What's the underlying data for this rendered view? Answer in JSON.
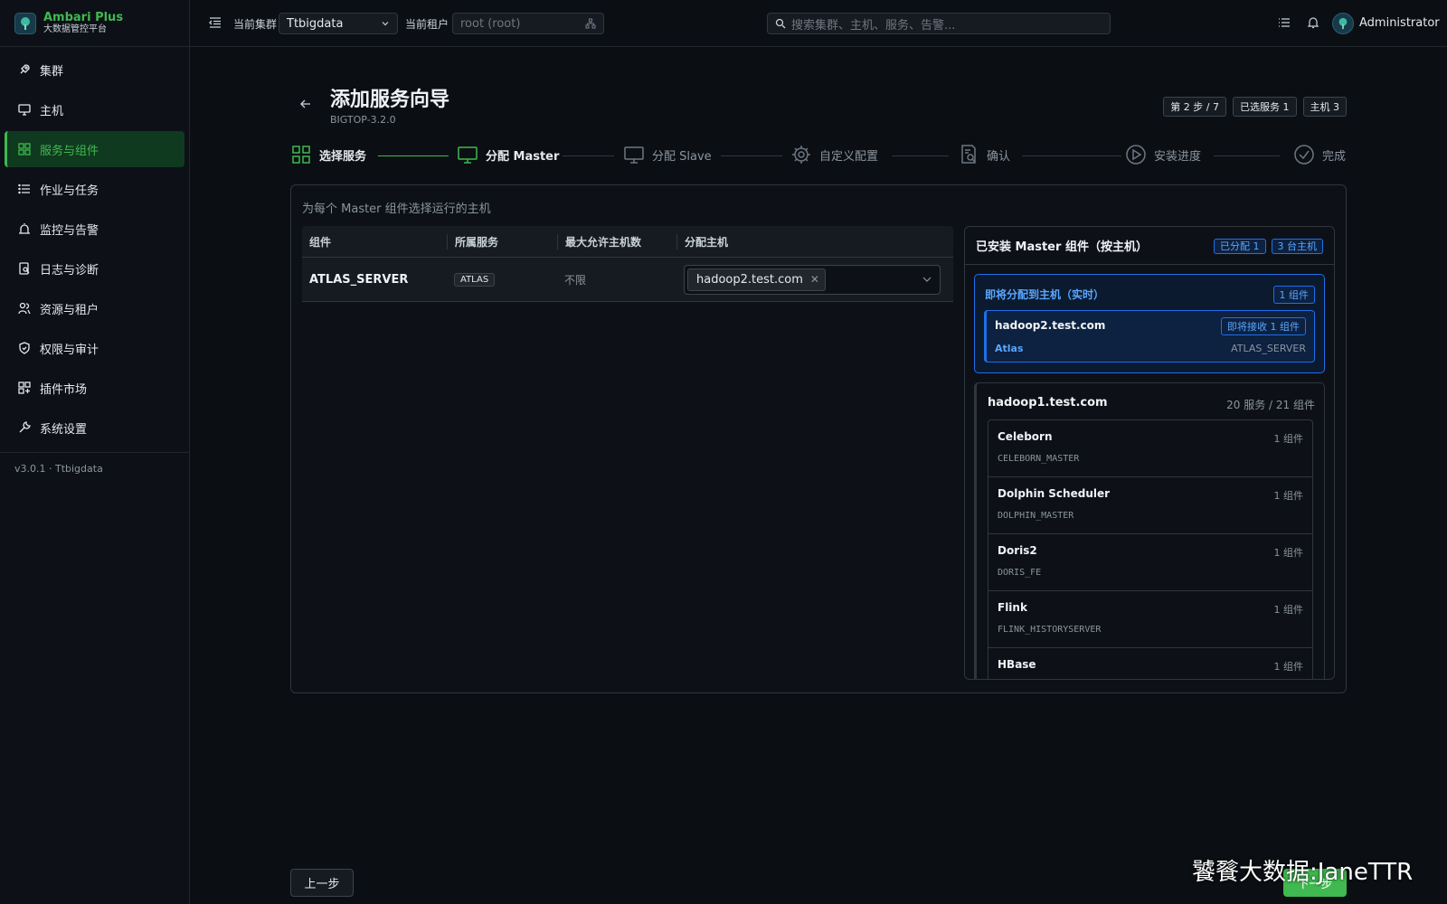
{
  "brand": {
    "title": "Ambari Plus",
    "subtitle": "大数据管控平台"
  },
  "sidebar": {
    "items": [
      {
        "label": "集群",
        "icon": "rocket-icon"
      },
      {
        "label": "主机",
        "icon": "monitor-icon"
      },
      {
        "label": "服务与组件",
        "icon": "grid-icon",
        "active": true
      },
      {
        "label": "作业与任务",
        "icon": "list-icon"
      },
      {
        "label": "监控与告警",
        "icon": "alarm-icon"
      },
      {
        "label": "日志与诊断",
        "icon": "log-icon"
      },
      {
        "label": "资源与租户",
        "icon": "users-icon"
      },
      {
        "label": "权限与审计",
        "icon": "shield-icon"
      },
      {
        "label": "插件市场",
        "icon": "puzzle-icon"
      },
      {
        "label": "系统设置",
        "icon": "wrench-icon"
      }
    ],
    "version": "v3.0.1 · Ttbigdata"
  },
  "topbar": {
    "cluster_label": "当前集群",
    "cluster_value": "Ttbigdata",
    "tenant_label": "当前租户",
    "tenant_placeholder": "root (root)",
    "search_placeholder": "搜索集群、主机、服务、告警...",
    "user_name": "Administrator"
  },
  "page": {
    "title": "添加服务向导",
    "subtitle": "BIGTOP-3.2.0",
    "badges": [
      "第 2 步 / 7",
      "已选服务 1",
      "主机 3"
    ]
  },
  "steps": [
    {
      "label": "选择服务",
      "state": "done",
      "icon": "grid-icon"
    },
    {
      "label": "分配 Master",
      "state": "current",
      "icon": "monitor-icon"
    },
    {
      "label": "分配 Slave",
      "state": "pending",
      "icon": "monitor-icon"
    },
    {
      "label": "自定义配置",
      "state": "pending",
      "icon": "gear-icon"
    },
    {
      "label": "确认",
      "state": "pending",
      "icon": "document-search-icon"
    },
    {
      "label": "安装进度",
      "state": "pending",
      "icon": "play-circle-icon"
    },
    {
      "label": "完成",
      "state": "pending",
      "icon": "check-circle-icon"
    }
  ],
  "assign": {
    "hint": "为每个 Master 组件选择运行的主机",
    "columns": [
      "组件",
      "所属服务",
      "最大允许主机数",
      "分配主机"
    ],
    "rows": [
      {
        "component": "ATLAS_SERVER",
        "service": "ATLAS",
        "max_hosts": "不限",
        "host": "hadoop2.test.com"
      }
    ]
  },
  "installed": {
    "title": "已安装 Master 组件（按主机）",
    "assigned_badge": "已分配 1",
    "hosts_badge": "3 台主机",
    "pending": {
      "title": "即将分配到主机（实时）",
      "badge": "1 组件",
      "host": "hadoop2.test.com",
      "host_badge": "即将接收 1 组件",
      "service": "Atlas",
      "component": "ATLAS_SERVER"
    },
    "host_group": {
      "host": "hadoop1.test.com",
      "summary": "20 服务 / 21 组件",
      "services": [
        {
          "name": "Celeborn",
          "count": "1 组件",
          "component": "CELEBORN_MASTER"
        },
        {
          "name": "Dolphin Scheduler",
          "count": "1 组件",
          "component": "DOLPHIN_MASTER"
        },
        {
          "name": "Doris2",
          "count": "1 组件",
          "component": "DORIS_FE"
        },
        {
          "name": "Flink",
          "count": "1 组件",
          "component": "FLINK_HISTORYSERVER"
        },
        {
          "name": "HBase",
          "count": "1 组件",
          "component": ""
        }
      ]
    }
  },
  "footer": {
    "prev_label": "上一步",
    "next_label": "下一步"
  },
  "watermark": "饕餮大数据:JaneTTR",
  "colors": {
    "accent": "#3fb950",
    "info": "#58a6ff",
    "background": "#0b0f14"
  }
}
